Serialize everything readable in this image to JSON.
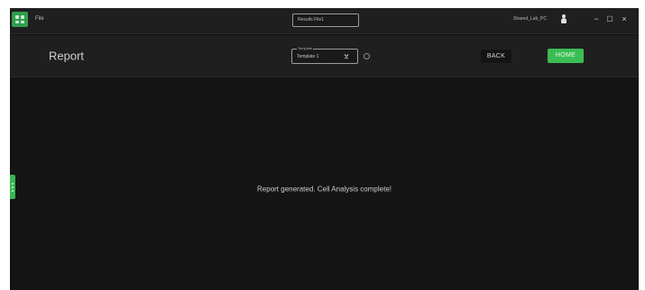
{
  "titlebar": {
    "menu_file": "File",
    "file_field_value": "Results File1",
    "user_name": "Shared_Lab_PC",
    "minimize_label": "−",
    "maximize_label": "▢",
    "close_label": "×"
  },
  "header": {
    "title": "Report",
    "template_legend": "Template",
    "template_value": "Template 1",
    "back_label": "BACK",
    "home_label": "HOME"
  },
  "content": {
    "message": "Report generated. Cell Analysis complete!"
  },
  "colors": {
    "accent": "#3bbd55",
    "background": "#141414",
    "bar": "#1f1f1f"
  },
  "icons": {
    "app": "app-grid-icon",
    "user": "user-icon",
    "dropdown": "dropdown-icon",
    "settings": "settings-icon",
    "side_tab": "side-panel-handle-icon"
  }
}
